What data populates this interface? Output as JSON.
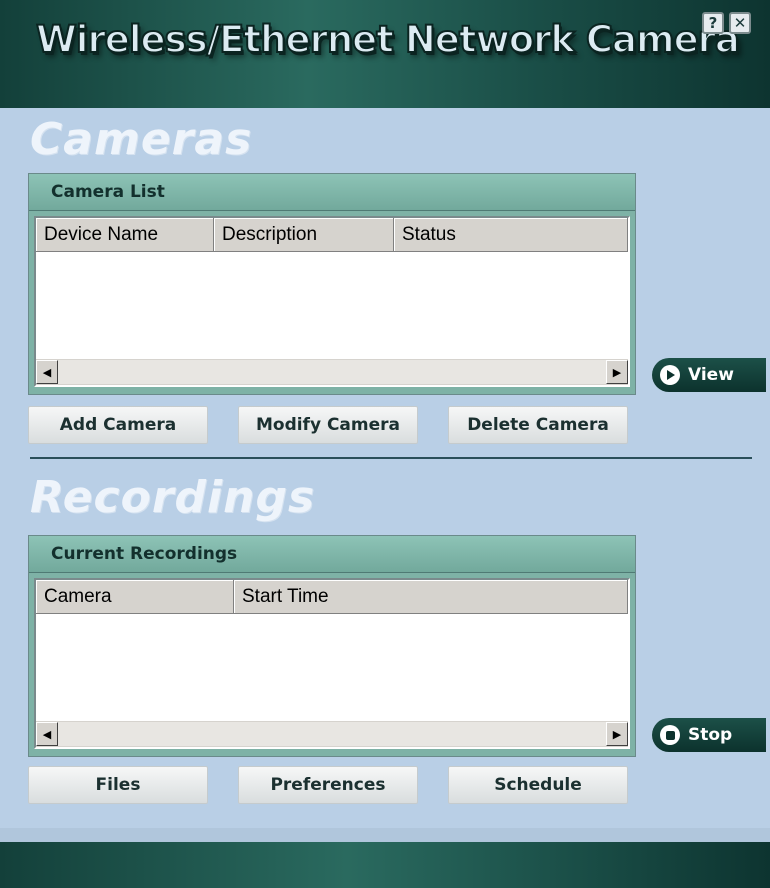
{
  "window": {
    "title": "Wireless/Ethernet Network Camera",
    "help_label": "?",
    "close_label": "✕"
  },
  "cameras": {
    "section_title": "Cameras",
    "panel_title": "Camera List",
    "columns": [
      "Device Name",
      "Description",
      "Status"
    ],
    "rows": [],
    "view_button": "View",
    "buttons": {
      "add": "Add Camera",
      "modify": "Modify Camera",
      "delete": "Delete Camera"
    }
  },
  "recordings": {
    "section_title": "Recordings",
    "panel_title": "Current Recordings",
    "columns": [
      "Camera",
      "Start Time"
    ],
    "rows": [],
    "stop_button": "Stop",
    "buttons": {
      "files": "Files",
      "preferences": "Preferences",
      "schedule": "Schedule"
    }
  },
  "icons": {
    "scroll_left": "◀",
    "scroll_right": "▶"
  },
  "colors": {
    "accent_dark": "#13403a",
    "panel_header": "#7eb2a6",
    "background": "#b9cfe6"
  }
}
